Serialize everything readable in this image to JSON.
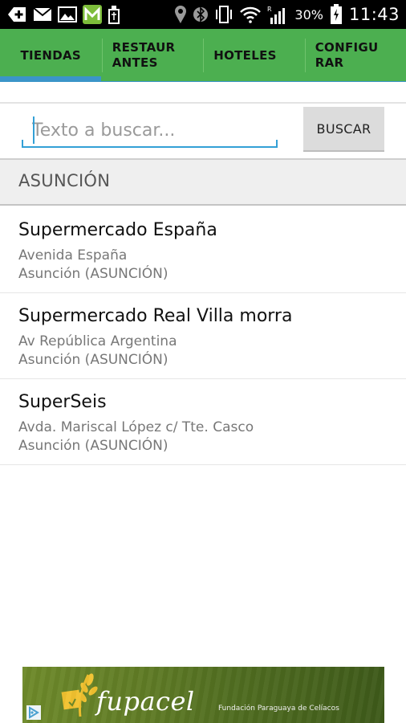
{
  "status_bar": {
    "left_icons": [
      "plus-icon",
      "email-icon",
      "image-icon",
      "m-app-icon",
      "usb-icon"
    ],
    "right_icons": [
      "location-icon",
      "bluetooth-icon",
      "vibrate-icon",
      "wifi-icon",
      "signal-icon",
      "battery-charging-icon"
    ],
    "network_label": "R",
    "battery": "30%",
    "time": "11:43"
  },
  "tabs": [
    {
      "label": "TIENDAS",
      "active": true
    },
    {
      "label": "RESTAUR\nANTES",
      "active": false
    },
    {
      "label": "HOTELES",
      "active": false
    },
    {
      "label": "CONFIGU\nRAR",
      "active": false
    }
  ],
  "search": {
    "placeholder": "Texto a buscar...",
    "value": "",
    "button_label": "BUSCAR"
  },
  "section": {
    "title": "ASUNCIÓN"
  },
  "stores": [
    {
      "name": "Supermercado España",
      "address": "Avenida España",
      "city": "Asunción (ASUNCIÓN)"
    },
    {
      "name": "Supermercado Real Villa morra",
      "address": "Av República Argentina",
      "city": "Asunción (ASUNCIÓN)"
    },
    {
      "name": "SuperSeis",
      "address": "Avda. Mariscal López c/ Tte. Casco",
      "city": "Asunción (ASUNCIÓN)"
    }
  ],
  "ad": {
    "brand": "fupacel",
    "tagline": "Fundación Paraguaya de Celíacos",
    "icon": "ad-choices-icon"
  },
  "colors": {
    "status_bar": "#000000",
    "tab_bar": "#4caf50",
    "accent": "#3b95c8",
    "section_bg": "#efefef",
    "button_bg": "#dcdcdc"
  }
}
